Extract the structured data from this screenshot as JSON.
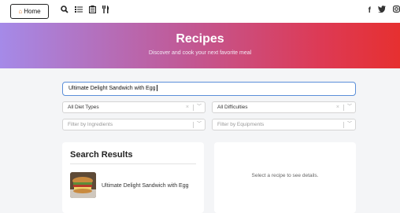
{
  "nav": {
    "home_label": "Home",
    "icons": [
      "search-icon",
      "list-icon",
      "clipboard-icon",
      "utensils-icon"
    ],
    "social_icons": [
      "facebook-icon",
      "twitter-icon",
      "instagram-icon"
    ]
  },
  "hero": {
    "title": "Recipes",
    "subtitle": "Discover and cook your next favorite meal",
    "gradient_colors": [
      "#a58ae8",
      "#c05a98",
      "#dd3a55",
      "#e63030"
    ]
  },
  "search": {
    "value": "Ultimate Delight Sandwich with Egg"
  },
  "filters": {
    "diet": "All Diet Types",
    "difficulty": "All Difficulties",
    "ingredients_placeholder": "Filter by Ingredients",
    "equipments_placeholder": "Filter by Equipments"
  },
  "results": {
    "title": "Search Results",
    "items": [
      {
        "name": "Ultimate Delight Sandwich with Egg"
      }
    ]
  },
  "details": {
    "empty_message": "Select a recipe to see details."
  },
  "colors": {
    "search_border": "#5b8fd9",
    "page_bg": "#f4f5f7"
  }
}
